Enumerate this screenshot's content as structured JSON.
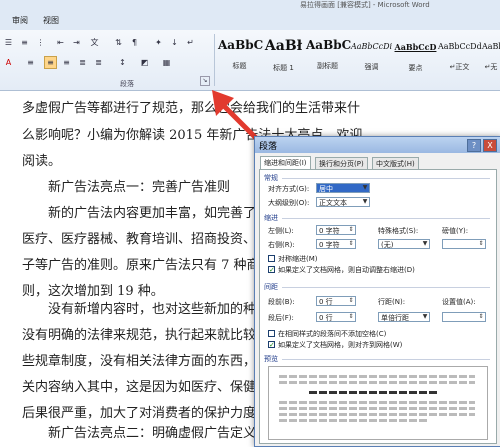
{
  "window": {
    "title": "易拉得画面 [兼容模式] - Microsoft Word"
  },
  "tabs": [
    "审阅",
    "视图"
  ],
  "ribbon": {
    "paragraph_group_label": "段落",
    "styles": [
      {
        "preview": "AaBbC",
        "name": "标题"
      },
      {
        "preview": "AaBł",
        "name": "标题 1"
      },
      {
        "preview": "AaBbC",
        "name": "副标题"
      },
      {
        "preview": "AaBbCcDi",
        "name": "强调"
      },
      {
        "preview": "AaBbCcD",
        "name": "要点"
      },
      {
        "preview": "AaBbCcDd",
        "name": "↵正文"
      },
      {
        "preview": "AaBbC",
        "name": "↵无"
      }
    ]
  },
  "document": {
    "lines": [
      "多虚假广告等都进行了规范，那么它会给我们的生活带来什",
      "么影响呢？小编为你解读 2015 年新广告法十大亮点，欢迎",
      "阅读。",
      "新广告法亮点一：完善广告准则",
      "新的广告法内容更加丰富，如完善了",
      "医疗、医疗器械、教育培训、招商投资、",
      "子等广告的准则。原来广告法只有 7 种商",
      "则，这次增加到 19 种。",
      "没有新增内容时，也对这些新加的种",
      "没有明确的法律来规范，执行起来就比较",
      "些规章制度，没有相关法律方面的东西，",
      "关内容纳入其中，这是因为如医疗、保健",
      "后果很严重，加大了对消费者的保护力度",
      "新广告法亮点二：明确虚假广告定义"
    ]
  },
  "dialog": {
    "title": "段落",
    "help_label": "?",
    "close_label": "X",
    "tabs": [
      "缩进和间距(I)",
      "换行和分页(P)",
      "中文版式(H)"
    ],
    "general": {
      "section": "常规",
      "alignment_label": "对齐方式(G):",
      "alignment_value": "居中",
      "outline_label": "大纲级别(O):",
      "outline_value": "正文文本"
    },
    "indent": {
      "section": "缩进",
      "left_label": "左侧(L):",
      "left_value": "0 字符",
      "right_label": "右侧(R):",
      "right_value": "0 字符",
      "special_label": "特殊格式(S):",
      "special_value": "(无)",
      "by_label": "磅值(Y):",
      "mirror_label": "对称缩进(M)",
      "auto_adjust_label": "如果定义了文档网格，则自动调整右缩进(D)"
    },
    "spacing": {
      "section": "间距",
      "before_label": "段前(B):",
      "before_value": "0 行",
      "after_label": "段后(F):",
      "after_value": "0 行",
      "line_label": "行距(N):",
      "line_value": "单倍行距",
      "at_label": "设置值(A):",
      "no_space_label": "在相同样式的段落间不添加空格(C)",
      "snap_grid_label": "如果定义了文档网格，则对齐到网格(W)"
    },
    "preview": {
      "section": "预览"
    }
  },
  "colors": {
    "accent": "#3169c6",
    "arrow": "#e23a2e"
  }
}
